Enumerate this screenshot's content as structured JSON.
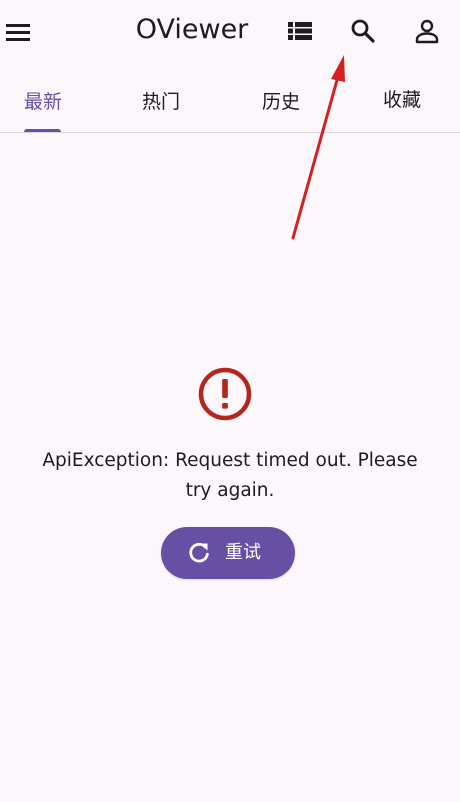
{
  "app_bar": {
    "title": "OViewer",
    "icons": {
      "menu": "menu-icon",
      "list": "list-view-icon",
      "search": "search-icon",
      "account": "account-icon"
    }
  },
  "tabs": [
    {
      "label": "最新",
      "active": true
    },
    {
      "label": "热门",
      "active": false
    },
    {
      "label": "历史",
      "active": false
    },
    {
      "label": "收藏",
      "active": false
    }
  ],
  "error": {
    "icon": "error-icon",
    "message": "ApiException: Request timed out. Please try again.",
    "retry_label": "重试",
    "retry_icon": "refresh-icon"
  },
  "colors": {
    "background": "#FCF7FA",
    "accent": "#6750A4",
    "error": "#B3261E",
    "annotation_arrow": "#D32020"
  }
}
